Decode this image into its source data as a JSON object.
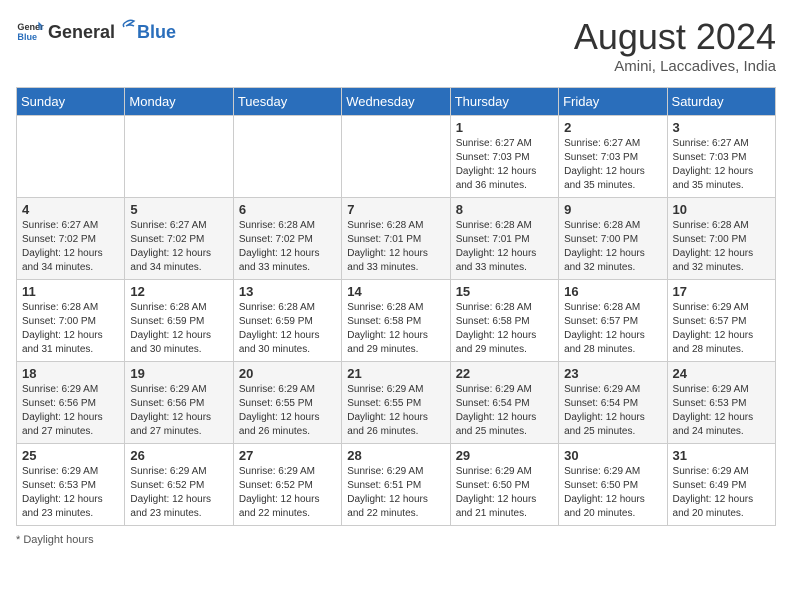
{
  "header": {
    "logo_general": "General",
    "logo_blue": "Blue",
    "month_title": "August 2024",
    "subtitle": "Amini, Laccadives, India"
  },
  "days_of_week": [
    "Sunday",
    "Monday",
    "Tuesday",
    "Wednesday",
    "Thursday",
    "Friday",
    "Saturday"
  ],
  "weeks": [
    [
      {
        "day": "",
        "info": ""
      },
      {
        "day": "",
        "info": ""
      },
      {
        "day": "",
        "info": ""
      },
      {
        "day": "",
        "info": ""
      },
      {
        "day": "1",
        "info": "Sunrise: 6:27 AM\nSunset: 7:03 PM\nDaylight: 12 hours and 36 minutes."
      },
      {
        "day": "2",
        "info": "Sunrise: 6:27 AM\nSunset: 7:03 PM\nDaylight: 12 hours and 35 minutes."
      },
      {
        "day": "3",
        "info": "Sunrise: 6:27 AM\nSunset: 7:03 PM\nDaylight: 12 hours and 35 minutes."
      }
    ],
    [
      {
        "day": "4",
        "info": "Sunrise: 6:27 AM\nSunset: 7:02 PM\nDaylight: 12 hours and 34 minutes."
      },
      {
        "day": "5",
        "info": "Sunrise: 6:27 AM\nSunset: 7:02 PM\nDaylight: 12 hours and 34 minutes."
      },
      {
        "day": "6",
        "info": "Sunrise: 6:28 AM\nSunset: 7:02 PM\nDaylight: 12 hours and 33 minutes."
      },
      {
        "day": "7",
        "info": "Sunrise: 6:28 AM\nSunset: 7:01 PM\nDaylight: 12 hours and 33 minutes."
      },
      {
        "day": "8",
        "info": "Sunrise: 6:28 AM\nSunset: 7:01 PM\nDaylight: 12 hours and 33 minutes."
      },
      {
        "day": "9",
        "info": "Sunrise: 6:28 AM\nSunset: 7:00 PM\nDaylight: 12 hours and 32 minutes."
      },
      {
        "day": "10",
        "info": "Sunrise: 6:28 AM\nSunset: 7:00 PM\nDaylight: 12 hours and 32 minutes."
      }
    ],
    [
      {
        "day": "11",
        "info": "Sunrise: 6:28 AM\nSunset: 7:00 PM\nDaylight: 12 hours and 31 minutes."
      },
      {
        "day": "12",
        "info": "Sunrise: 6:28 AM\nSunset: 6:59 PM\nDaylight: 12 hours and 30 minutes."
      },
      {
        "day": "13",
        "info": "Sunrise: 6:28 AM\nSunset: 6:59 PM\nDaylight: 12 hours and 30 minutes."
      },
      {
        "day": "14",
        "info": "Sunrise: 6:28 AM\nSunset: 6:58 PM\nDaylight: 12 hours and 29 minutes."
      },
      {
        "day": "15",
        "info": "Sunrise: 6:28 AM\nSunset: 6:58 PM\nDaylight: 12 hours and 29 minutes."
      },
      {
        "day": "16",
        "info": "Sunrise: 6:28 AM\nSunset: 6:57 PM\nDaylight: 12 hours and 28 minutes."
      },
      {
        "day": "17",
        "info": "Sunrise: 6:29 AM\nSunset: 6:57 PM\nDaylight: 12 hours and 28 minutes."
      }
    ],
    [
      {
        "day": "18",
        "info": "Sunrise: 6:29 AM\nSunset: 6:56 PM\nDaylight: 12 hours and 27 minutes."
      },
      {
        "day": "19",
        "info": "Sunrise: 6:29 AM\nSunset: 6:56 PM\nDaylight: 12 hours and 27 minutes."
      },
      {
        "day": "20",
        "info": "Sunrise: 6:29 AM\nSunset: 6:55 PM\nDaylight: 12 hours and 26 minutes."
      },
      {
        "day": "21",
        "info": "Sunrise: 6:29 AM\nSunset: 6:55 PM\nDaylight: 12 hours and 26 minutes."
      },
      {
        "day": "22",
        "info": "Sunrise: 6:29 AM\nSunset: 6:54 PM\nDaylight: 12 hours and 25 minutes."
      },
      {
        "day": "23",
        "info": "Sunrise: 6:29 AM\nSunset: 6:54 PM\nDaylight: 12 hours and 25 minutes."
      },
      {
        "day": "24",
        "info": "Sunrise: 6:29 AM\nSunset: 6:53 PM\nDaylight: 12 hours and 24 minutes."
      }
    ],
    [
      {
        "day": "25",
        "info": "Sunrise: 6:29 AM\nSunset: 6:53 PM\nDaylight: 12 hours and 23 minutes."
      },
      {
        "day": "26",
        "info": "Sunrise: 6:29 AM\nSunset: 6:52 PM\nDaylight: 12 hours and 23 minutes."
      },
      {
        "day": "27",
        "info": "Sunrise: 6:29 AM\nSunset: 6:52 PM\nDaylight: 12 hours and 22 minutes."
      },
      {
        "day": "28",
        "info": "Sunrise: 6:29 AM\nSunset: 6:51 PM\nDaylight: 12 hours and 22 minutes."
      },
      {
        "day": "29",
        "info": "Sunrise: 6:29 AM\nSunset: 6:50 PM\nDaylight: 12 hours and 21 minutes."
      },
      {
        "day": "30",
        "info": "Sunrise: 6:29 AM\nSunset: 6:50 PM\nDaylight: 12 hours and 20 minutes."
      },
      {
        "day": "31",
        "info": "Sunrise: 6:29 AM\nSunset: 6:49 PM\nDaylight: 12 hours and 20 minutes."
      }
    ]
  ],
  "footer": {
    "note": "Daylight hours"
  }
}
